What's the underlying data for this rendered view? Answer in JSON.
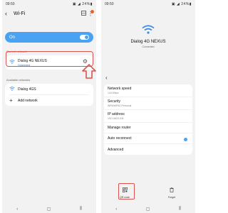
{
  "left": {
    "status": {
      "time": "09:50",
      "icons": "▣ ◢ 24%▮"
    },
    "appbar": {
      "back": "‹",
      "title": "Wi-Fi",
      "qr_icon": "QR",
      "more": "⋮"
    },
    "wifi_toggle": {
      "label": "On"
    },
    "current_label": "Current network",
    "current": {
      "name": "Dialog 4G NEXUS",
      "status": "Connected",
      "settings_icon": "⚙"
    },
    "available_label": "Available networks",
    "available": [
      {
        "name": "Dialog 4GS",
        "icon": "wifi-icon"
      },
      {
        "name": "Add network",
        "icon": "plus-icon"
      }
    ],
    "nav": [
      "‹",
      "▢",
      "⫼"
    ]
  },
  "right": {
    "status": {
      "time": "09:50",
      "icons": "▣ ◢ 24%▮"
    },
    "network": {
      "name": "Dialog 4G NEXUS",
      "status": "Connected"
    },
    "back": "‹",
    "details": [
      {
        "label": "Network speed",
        "value": "144 Mbps"
      },
      {
        "label": "Security",
        "value": "WPA/WPA2-Personal"
      },
      {
        "label": "IP address",
        "value": "192.168.8.105"
      },
      {
        "label": "Manage router",
        "value": ""
      },
      {
        "label": "Auto reconnect",
        "value": "",
        "toggle": true
      },
      {
        "label": "Advanced",
        "value": ""
      }
    ],
    "actions": [
      {
        "label": "QR code",
        "icon": "qr-icon"
      },
      {
        "label": "Forget",
        "icon": "trash-icon"
      }
    ],
    "nav": [
      "‹",
      "▢",
      "⫼"
    ]
  },
  "colors": {
    "accent": "#4aa3f2",
    "highlight": "#d9534f"
  }
}
